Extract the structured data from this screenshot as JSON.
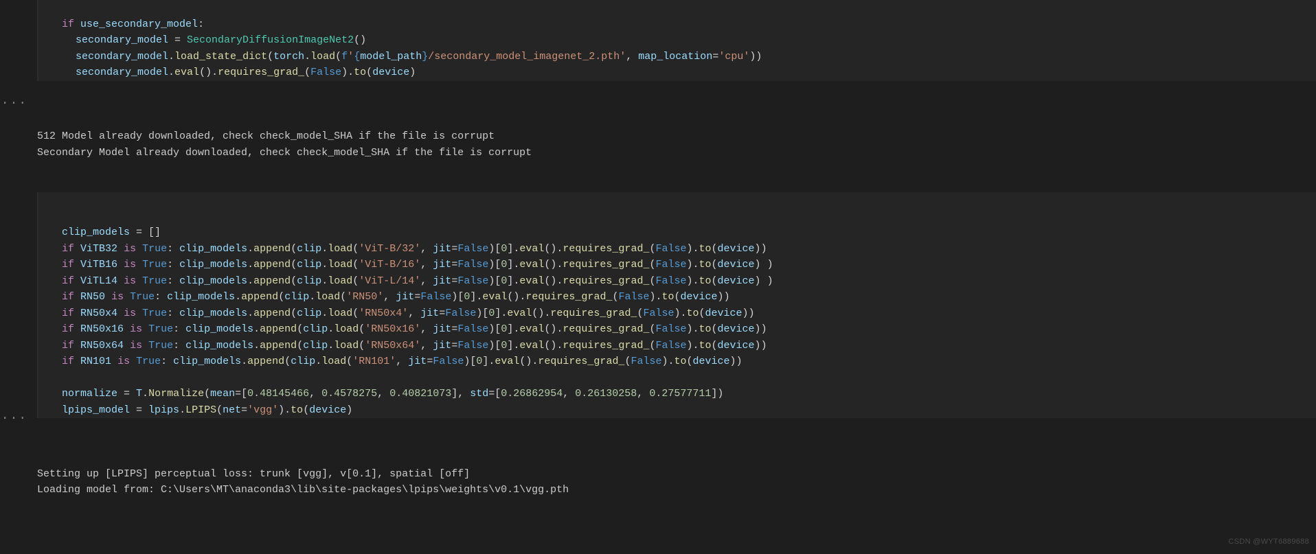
{
  "cell1": {
    "if_kw": "if",
    "use_secondary_model": "use_secondary_model",
    "secondary_model": "secondary_model",
    "assign": " = ",
    "class_name": "SecondaryDiffusionImageNet2",
    "load_state_dict": "load_state_dict",
    "torch": "torch",
    "load": "load",
    "f_prefix": "f",
    "str_open": "'",
    "interp_open": "{",
    "model_path": "model_path",
    "interp_close": "}",
    "str_tail": "/secondary_model_imagenet_2.pth'",
    "map_loc_kw": "map_location",
    "map_loc_val": "'cpu'",
    "eval": "eval",
    "requires_grad": "requires_grad_",
    "false": "False",
    "to": "to",
    "device": "device"
  },
  "out1": {
    "l1": "512 Model already downloaded, check check_model_SHA if the file is corrupt",
    "l2": "Secondary Model already downloaded, check check_model_SHA if the file is corrupt"
  },
  "cell2": {
    "clip_models": "clip_models",
    "eq": " = []",
    "if_kw": "if",
    "is_kw": "is",
    "true": "True",
    "append": "append",
    "clip": "clip",
    "load": "load",
    "jit": "jit",
    "false": "False",
    "eval": "eval",
    "requires_grad": "requires_grad_",
    "to": "to",
    "device": "device",
    "models": {
      "ViTB32": {
        "flag": "ViTB32",
        "name": "'ViT-B/32'",
        "trail": ")"
      },
      "ViTB16": {
        "flag": "ViTB16",
        "name": "'ViT-B/16'",
        "trail": " )"
      },
      "ViTL14": {
        "flag": "ViTL14",
        "name": "'ViT-L/14'",
        "trail": " )"
      },
      "RN50": {
        "flag": "RN50",
        "name": "'RN50'",
        "trail": ")"
      },
      "RN50x4": {
        "flag": "RN50x4",
        "name": "'RN50x4'",
        "trail": ")"
      },
      "RN50x16": {
        "flag": "RN50x16",
        "name": "'RN50x16'",
        "trail": ")"
      },
      "RN50x64": {
        "flag": "RN50x64",
        "name": "'RN50x64'",
        "trail": ")"
      },
      "RN101": {
        "flag": "RN101",
        "name": "'RN101'",
        "trail": ")"
      }
    },
    "normalize": "normalize",
    "T": "T",
    "Normalize": "Normalize",
    "mean_kw": "mean",
    "mean_vals": [
      "0.48145466",
      "0.4578275",
      "0.40821073"
    ],
    "std_kw": "std",
    "std_vals": [
      "0.26862954",
      "0.26130258",
      "0.27577711"
    ],
    "lpips_model": "lpips_model",
    "lpips_mod": "lpips",
    "LPIPS": "LPIPS",
    "net_kw": "net",
    "net_val": "'vgg'"
  },
  "out2": {
    "l1": "Setting up [LPIPS] perceptual loss: trunk [vgg], v[0.1], spatial [off]",
    "l2": "Loading model from: C:\\Users\\MT\\anaconda3\\lib\\site-packages\\lpips\\weights\\v0.1\\vgg.pth"
  },
  "dots": "···",
  "watermark": "CSDN @WYT6889688"
}
